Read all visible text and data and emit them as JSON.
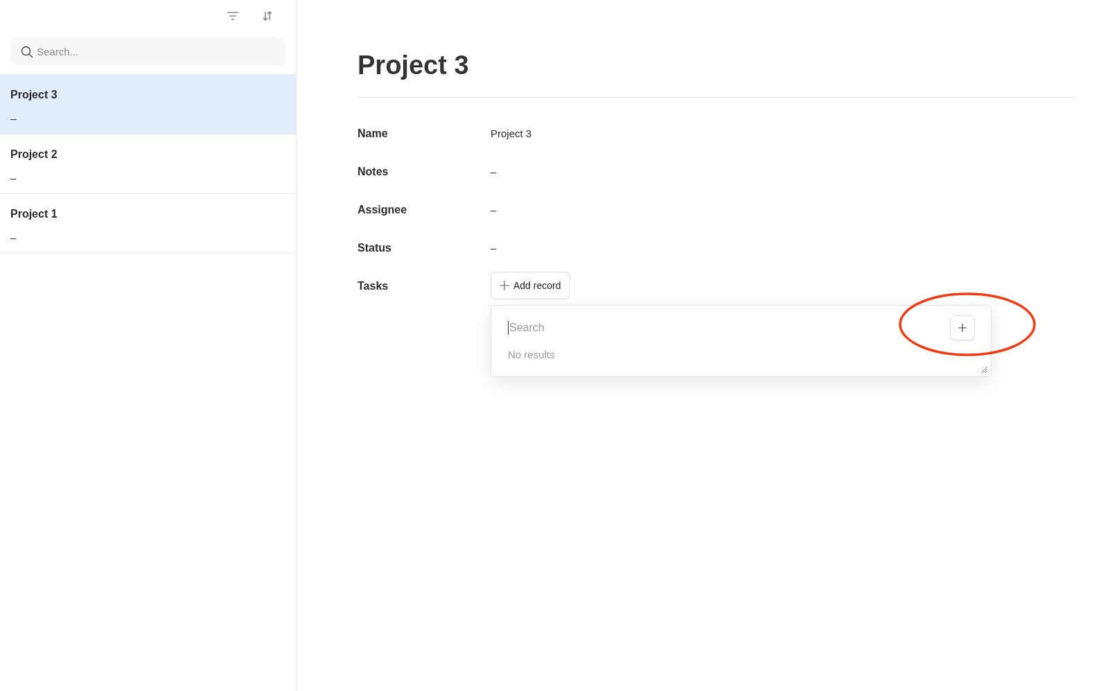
{
  "sidebar": {
    "search": {
      "placeholder": "Search..."
    },
    "items": [
      {
        "title": "Project 3",
        "subtitle": "–",
        "selected": true
      },
      {
        "title": "Project 2",
        "subtitle": "–",
        "selected": false
      },
      {
        "title": "Project 1",
        "subtitle": "–",
        "selected": false
      }
    ]
  },
  "detail": {
    "title": "Project 3",
    "fields": [
      {
        "label": "Name",
        "value": "Project 3"
      },
      {
        "label": "Notes",
        "value": "–"
      },
      {
        "label": "Assignee",
        "value": "–"
      },
      {
        "label": "Status",
        "value": "–"
      }
    ],
    "tasks": {
      "label": "Tasks",
      "button": "Add record",
      "popup": {
        "placeholder": "Search",
        "empty": "No results"
      }
    }
  }
}
